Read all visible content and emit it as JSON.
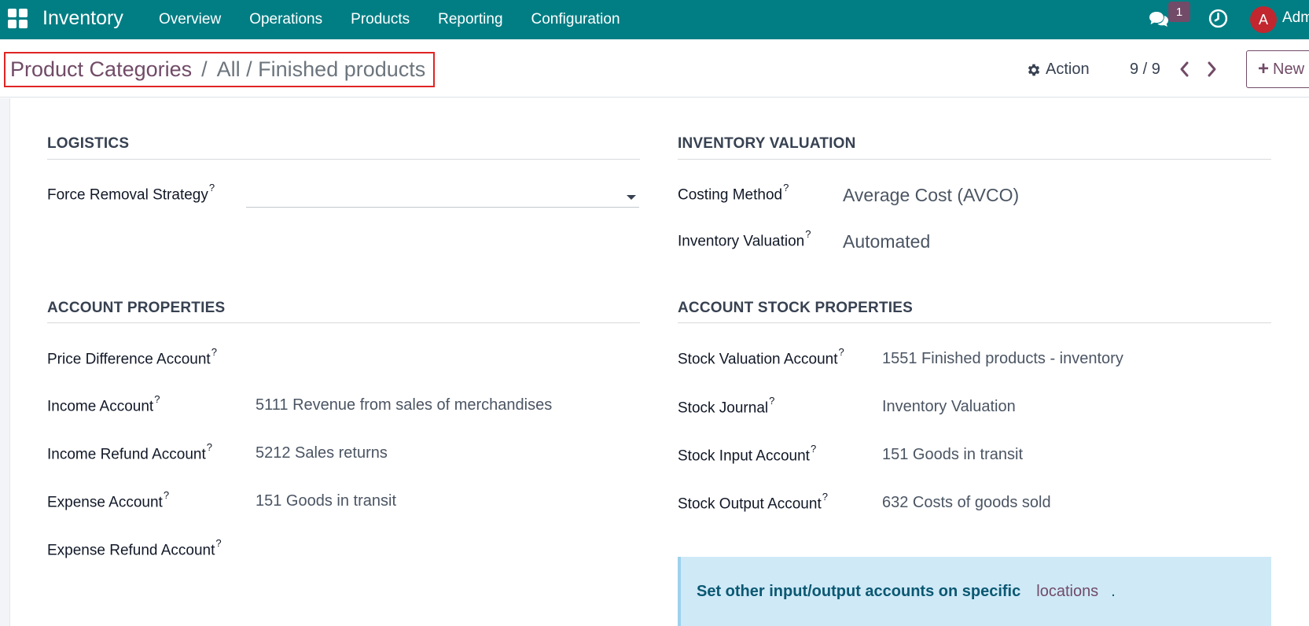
{
  "navbar": {
    "app_name": "Inventory",
    "menu": [
      "Overview",
      "Operations",
      "Products",
      "Reporting",
      "Configuration"
    ],
    "chat_badge": "1",
    "avatar_letter": "A",
    "user_name": "Adm",
    "colors": {
      "bar": "#017e84",
      "badge": "#714b67",
      "avatar": "#c2262f"
    }
  },
  "control_panel": {
    "breadcrumb": {
      "root": "Product Categories",
      "separator": "/",
      "current": "All / Finished products"
    },
    "action_label": "Action",
    "pager": "9 / 9",
    "new_label": "New"
  },
  "form": {
    "logistics": {
      "title": "LOGISTICS",
      "force_removal_label": "Force Removal Strategy",
      "force_removal_value": ""
    },
    "inventory_valuation": {
      "title": "INVENTORY VALUATION",
      "costing_method_label": "Costing Method",
      "costing_method_value": "Average Cost (AVCO)",
      "inventory_valuation_label": "Inventory Valuation",
      "inventory_valuation_value": "Automated"
    },
    "account_properties": {
      "title": "ACCOUNT PROPERTIES",
      "fields": [
        {
          "label": "Price Difference Account",
          "value": ""
        },
        {
          "label": "Income Account",
          "value": "5111 Revenue from sales of merchandises"
        },
        {
          "label": "Income Refund Account",
          "value": "5212 Sales returns"
        },
        {
          "label": "Expense Account",
          "value": "151 Goods in transit"
        },
        {
          "label": "Expense Refund Account",
          "value": ""
        }
      ]
    },
    "account_stock_properties": {
      "title": "ACCOUNT STOCK PROPERTIES",
      "fields": [
        {
          "label": "Stock Valuation Account",
          "value": "1551 Finished products - inventory"
        },
        {
          "label": "Stock Journal",
          "value": "Inventory Valuation"
        },
        {
          "label": "Stock Input Account",
          "value": "151 Goods in transit"
        },
        {
          "label": "Stock Output Account",
          "value": "632 Costs of goods sold"
        }
      ]
    },
    "alert": {
      "text": "Set other input/output accounts on specific",
      "link": "locations",
      "suffix": "."
    },
    "help_mark": "?"
  }
}
